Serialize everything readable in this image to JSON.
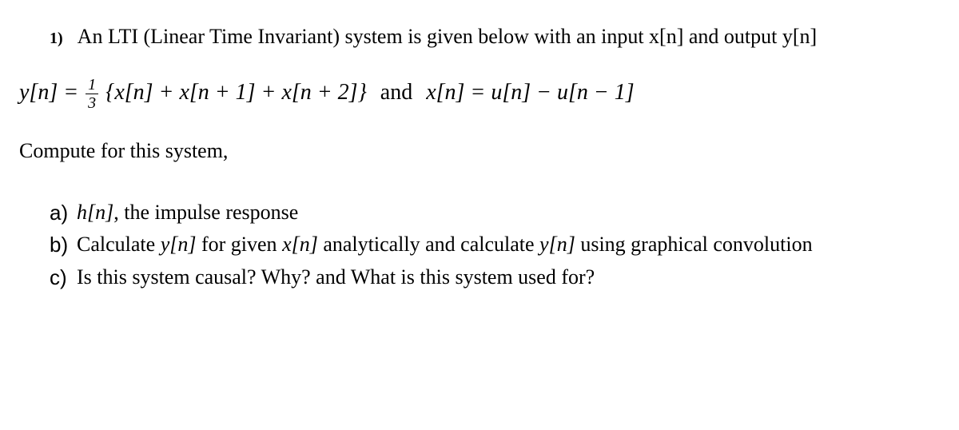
{
  "question": {
    "number": "1)",
    "intro": "An LTI (Linear Time Invariant) system is given below with an input x[n] and output y[n]",
    "equation_lhs": "y[n] = ",
    "frac_num": "1",
    "frac_den": "3",
    "equation_body": "{x[n] + x[n + 1] + x[n + 2]}",
    "and_word": "and",
    "equation_rhs": "x[n] = u[n] − u[n − 1]",
    "compute": "Compute for this system,",
    "parts": {
      "a": {
        "label": "a)",
        "hn": "h[n]",
        "rest": ", the impulse response"
      },
      "b": {
        "label": "b)",
        "pre": "Calculate ",
        "yn1": "y[n]",
        "mid1": " for given ",
        "xn": "x[n]",
        "mid2": " analytically and calculate ",
        "yn2": "y[n]",
        "post": " using graphical convolution"
      },
      "c": {
        "label": "c)",
        "text": "Is this system causal? Why? and What is this system used for?"
      }
    }
  }
}
